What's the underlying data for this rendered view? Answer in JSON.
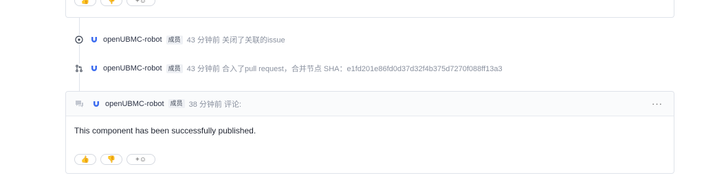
{
  "top_reactions": {
    "like": "👍",
    "dislike": "👎",
    "add": "+☺"
  },
  "events": [
    {
      "icon": "issue-closed-icon",
      "user": "openUBMC-robot",
      "badge": "成员",
      "meta": "43 分钟前 关闭了关联的issue"
    },
    {
      "icon": "pull-request-merged-icon",
      "user": "openUBMC-robot",
      "badge": "成员",
      "meta": "43 分钟前 合入了pull request，合并节点 SHA：e1fd201e86fd0d37d32f4b375d7270f088ff13a3"
    }
  ],
  "comment": {
    "user": "openUBMC-robot",
    "badge": "成员",
    "meta": "38 分钟前 评论:",
    "more": "···",
    "body": "This component has been successfully published.",
    "reactions": {
      "like": "👍",
      "dislike": "👎",
      "add": "+☺"
    }
  },
  "colors": {
    "brand_blue": "#3c6cf0",
    "border": "#dfe3ea",
    "muted": "#8a919f"
  }
}
